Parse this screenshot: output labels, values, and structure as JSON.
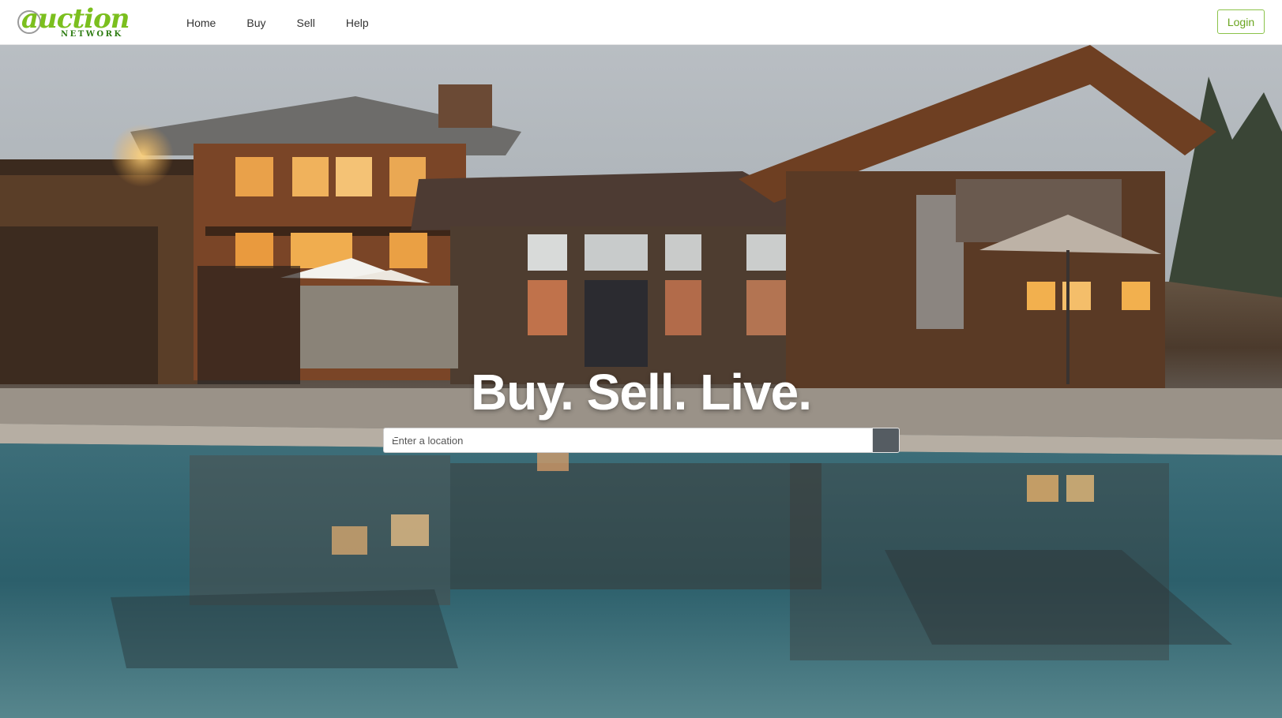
{
  "brand": {
    "name_main": "auction",
    "name_sub": "NETWORK",
    "accent": "#7bbf1e"
  },
  "nav": {
    "links": [
      "Home",
      "Buy",
      "Sell",
      "Help"
    ],
    "login_label": "Login"
  },
  "hero": {
    "headline": "Buy. Sell. Live.",
    "search": {
      "placeholder": "Enter a location",
      "value": "",
      "icon": "search-icon"
    }
  }
}
